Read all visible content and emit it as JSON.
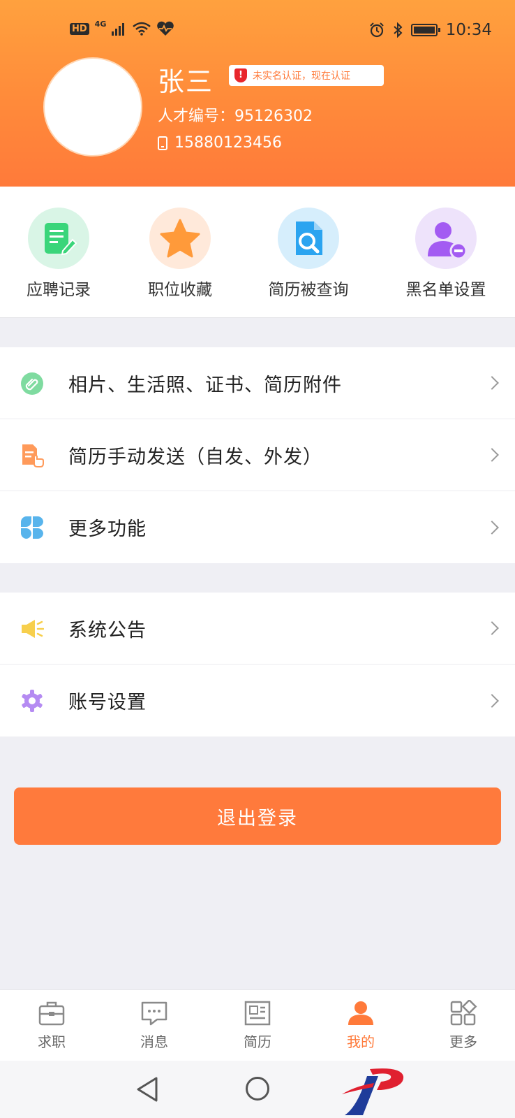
{
  "status_bar": {
    "hd": "HD",
    "network": "4G",
    "time": "10:34"
  },
  "profile": {
    "name": "张三",
    "verify_badge": "未实名认证，现在认证",
    "verify_badge_icon": "!",
    "talent_number": "人才编号：95126302",
    "phone": "15880123456"
  },
  "quick_actions": [
    {
      "label": "应聘记录",
      "icon": "document-edit-icon",
      "color": "#3ad57a"
    },
    {
      "label": "职位收藏",
      "icon": "star-icon",
      "color": "#ff9a3a"
    },
    {
      "label": "简历被查询",
      "icon": "document-search-icon",
      "color": "#2ba4f0"
    },
    {
      "label": "黑名单设置",
      "icon": "user-block-icon",
      "color": "#a35bf2"
    }
  ],
  "menu_group_1": [
    {
      "label": "相片、生活照、证书、简历附件",
      "icon": "attachment-icon"
    },
    {
      "label": "简历手动发送（自发、外发）",
      "icon": "resume-send-icon"
    },
    {
      "label": "更多功能",
      "icon": "grid-petals-icon"
    }
  ],
  "menu_group_2": [
    {
      "label": "系统公告",
      "icon": "speaker-icon"
    },
    {
      "label": "账号设置",
      "icon": "gear-icon"
    }
  ],
  "logout_label": "退出登录",
  "tabs": [
    {
      "label": "求职",
      "icon": "briefcase-icon"
    },
    {
      "label": "消息",
      "icon": "chat-icon"
    },
    {
      "label": "简历",
      "icon": "resume-icon"
    },
    {
      "label": "我的",
      "icon": "user-icon",
      "active": true
    },
    {
      "label": "更多",
      "icon": "more-grid-icon"
    }
  ],
  "colors": {
    "accent": "#ff7a3a",
    "header_top": "#ffa13e",
    "background": "#efeff4"
  }
}
